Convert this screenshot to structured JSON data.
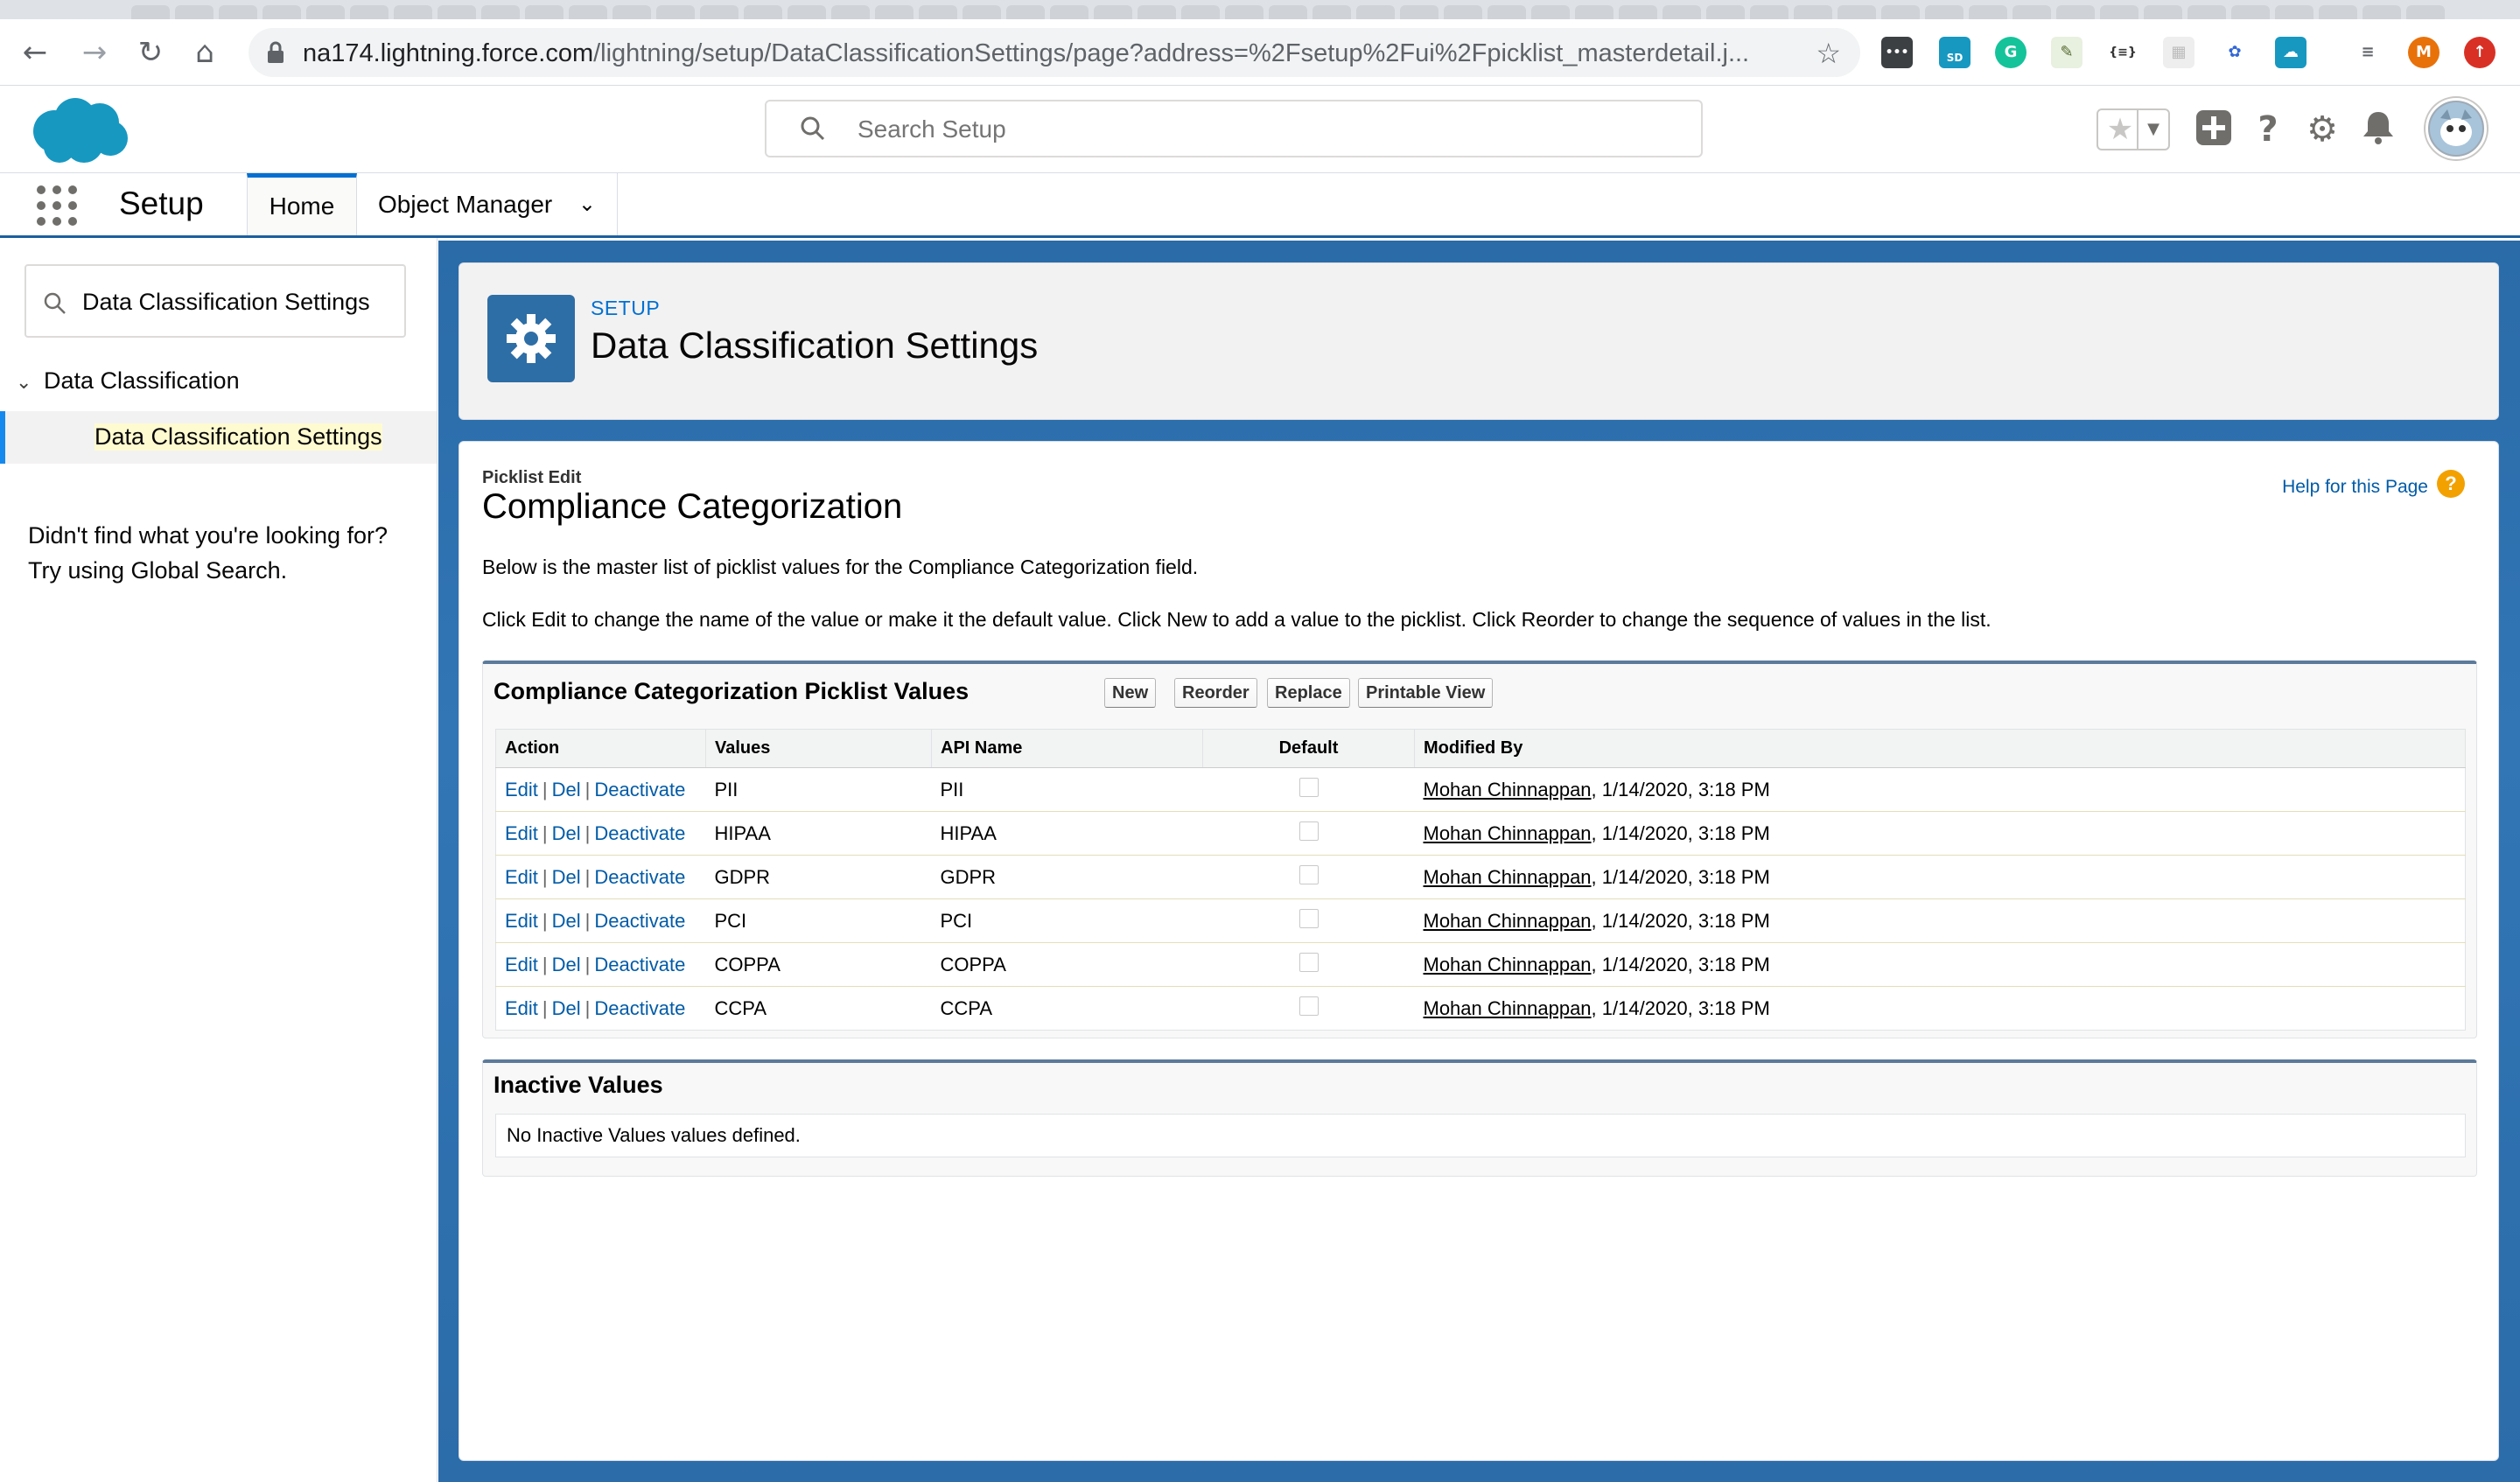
{
  "browser": {
    "url_host": "na174.lightning.force.com",
    "url_path": "/lightning/setup/DataClassificationSettings/page?address=%2Fsetup%2Fui%2Fpicklist_masterdetail.j...",
    "profile_initial": "M",
    "ext_sd_label": "SD",
    "ext_braces_label": "{≡}"
  },
  "header": {
    "search_placeholder": "Search Setup"
  },
  "context_bar": {
    "app_name": "Setup",
    "tabs": [
      {
        "label": "Home"
      },
      {
        "label": "Object Manager"
      }
    ]
  },
  "sidebar": {
    "quickfind_value": "Data Classification Settings",
    "tree_parent": "Data Classification",
    "tree_child": "Data Classification Settings",
    "help_line1": "Didn't find what you're looking for?",
    "help_line2": "Try using Global Search."
  },
  "page_header": {
    "kicker": "SETUP",
    "title": "Data Classification Settings"
  },
  "picklist": {
    "kicker": "Picklist Edit",
    "title": "Compliance Categorization",
    "help_link": "Help for this Page",
    "description1": "Below is the master list of picklist values for the Compliance Categorization field.",
    "description2": "Click Edit to change the name of the value or make it the default value. Click New to add a value to the picklist. Click Reorder to change the sequence of values in the list.",
    "values_block_title": "Compliance Categorization Picklist Values",
    "buttons": {
      "new": "New",
      "reorder": "Reorder",
      "replace": "Replace",
      "printable": "Printable View"
    },
    "columns": [
      "Action",
      "Values",
      "API Name",
      "Default",
      "Modified By"
    ],
    "actions": {
      "edit": "Edit",
      "del": "Del",
      "deactivate": "Deactivate",
      "separator": "|"
    },
    "rows": [
      {
        "value": "PII",
        "api_name": "PII",
        "default": false,
        "modified_by": "Mohan Chinnappan",
        "modified_at": ", 1/14/2020, 3:18 PM"
      },
      {
        "value": "HIPAA",
        "api_name": "HIPAA",
        "default": false,
        "modified_by": "Mohan Chinnappan",
        "modified_at": ", 1/14/2020, 3:18 PM"
      },
      {
        "value": "GDPR",
        "api_name": "GDPR",
        "default": false,
        "modified_by": "Mohan Chinnappan",
        "modified_at": ", 1/14/2020, 3:18 PM"
      },
      {
        "value": "PCI",
        "api_name": "PCI",
        "default": false,
        "modified_by": "Mohan Chinnappan",
        "modified_at": ", 1/14/2020, 3:18 PM"
      },
      {
        "value": "COPPA",
        "api_name": "COPPA",
        "default": false,
        "modified_by": "Mohan Chinnappan",
        "modified_at": ", 1/14/2020, 3:18 PM"
      },
      {
        "value": "CCPA",
        "api_name": "CCPA",
        "default": false,
        "modified_by": "Mohan Chinnappan",
        "modified_at": ", 1/14/2020, 3:18 PM"
      }
    ],
    "inactive_block_title": "Inactive Values",
    "inactive_message": "No Inactive Values values defined."
  },
  "icons": {
    "back": "back-arrow-icon",
    "forward": "forward-arrow-icon",
    "reload": "reload-icon",
    "home": "home-icon",
    "lock": "lock-icon",
    "star": "bookmark-star-icon",
    "search": "search-icon",
    "add": "plus-icon",
    "help": "question-icon",
    "settings": "gear-icon",
    "notifications": "bell-icon"
  },
  "colors": {
    "salesforce_blue": "#1798c1",
    "link_blue": "#015ba7",
    "brand_tile": "#2e6ea6",
    "active_tab_accent": "#0070d2",
    "highlight": "#fffbd1"
  }
}
